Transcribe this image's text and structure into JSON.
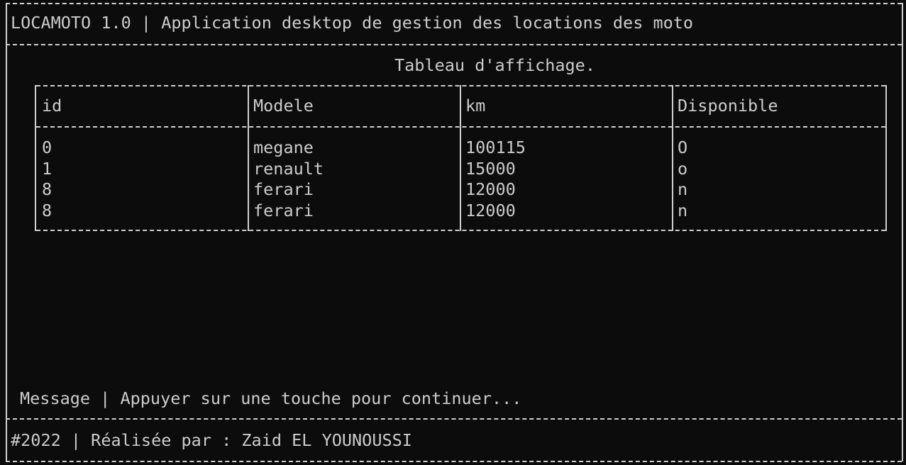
{
  "header": {
    "title": "LOCAMOTO 1.0 | Application desktop de gestion des locations des moto"
  },
  "main": {
    "title": "Tableau d'affichage.",
    "columns": [
      "id",
      "Modele",
      "km",
      "Disponible"
    ],
    "rows": [
      [
        "0",
        "megane",
        "100115",
        "O"
      ],
      [
        "1",
        "renault",
        "15000",
        "o"
      ],
      [
        "8",
        "ferari",
        "12000",
        "n"
      ],
      [
        "8",
        "ferari",
        "12000",
        "n"
      ]
    ]
  },
  "message": {
    "text": "Message | Appuyer sur une touche pour continuer..."
  },
  "footer": {
    "text": "#2022 | Réalisée par : Zaid EL YOUNOUSSI"
  }
}
